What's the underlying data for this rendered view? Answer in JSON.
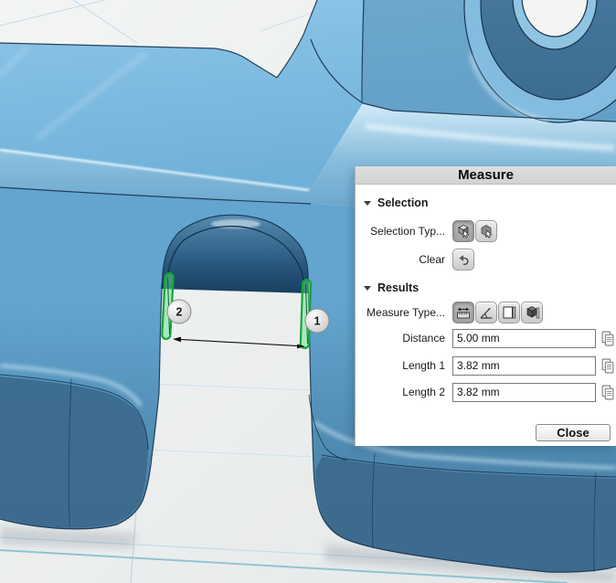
{
  "panel": {
    "title": "Measure",
    "selection": {
      "title": "Selection",
      "type_label": "Selection Typ...",
      "clear_label": "Clear"
    },
    "results": {
      "title": "Results",
      "measure_type_label": "Measure Type...",
      "fields": [
        {
          "label": "Distance",
          "value": "5.00 mm"
        },
        {
          "label": "Length 1",
          "value": "3.82 mm"
        },
        {
          "label": "Length 2",
          "value": "3.82 mm"
        }
      ]
    },
    "close_label": "Close"
  },
  "viewport": {
    "badges": [
      {
        "label": "1"
      },
      {
        "label": "2"
      }
    ]
  },
  "colors": {
    "part_blue": "#5fa3cd",
    "part_dark_blue": "#3c6a8d",
    "edge_line": "#16334d",
    "highlight_green": "#2fd157",
    "grid_teal": "#8fc5d3"
  }
}
